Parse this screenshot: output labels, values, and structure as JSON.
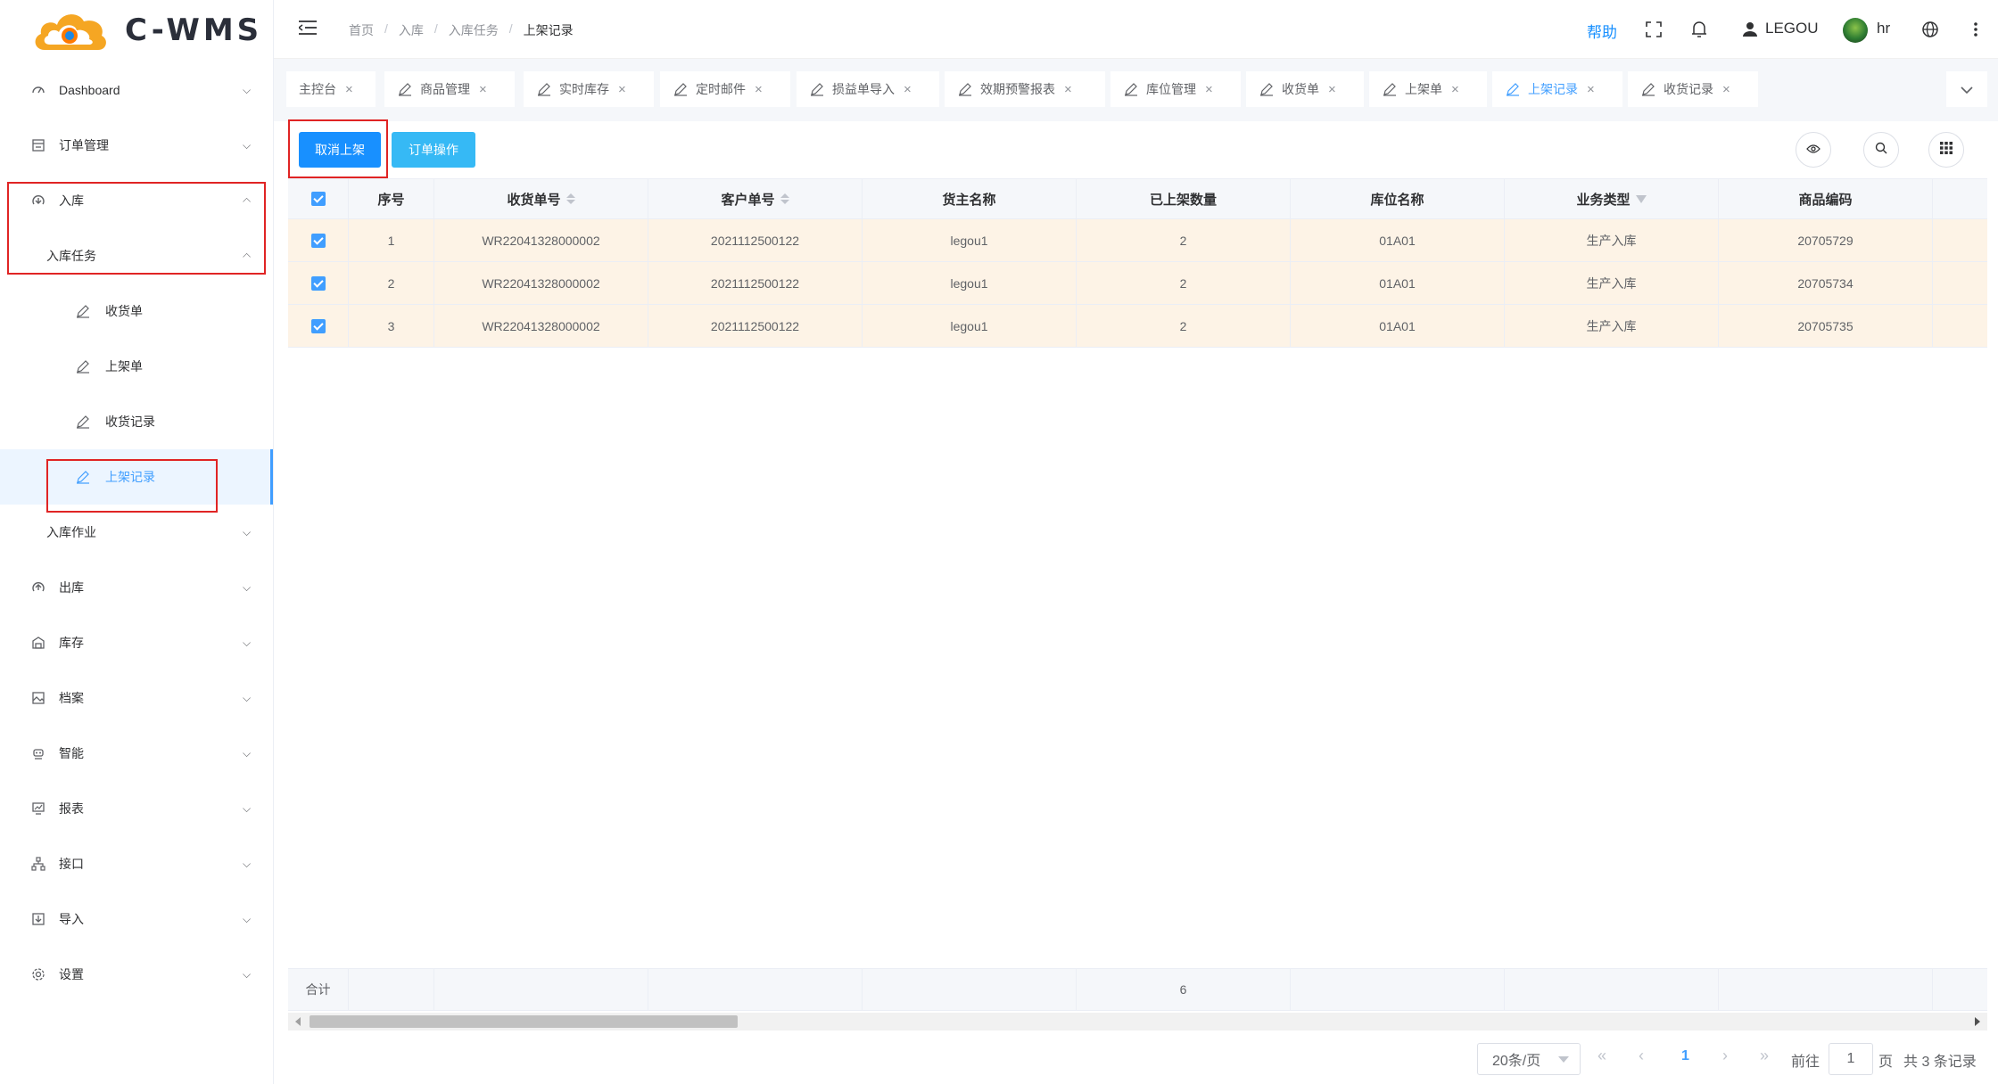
{
  "app": {
    "logo_text": "C-WMS"
  },
  "header": {
    "breadcrumb": [
      "首页",
      "入库",
      "入库任务",
      "上架记录"
    ],
    "help_label": "帮助",
    "user_label": "LEGOU",
    "account_name": "hr"
  },
  "sidebar": {
    "dashboard": "Dashboard",
    "order_mgmt": "订单管理",
    "inbound": "入库",
    "inbound_task": "入库任务",
    "receipt": "收货单",
    "putaway": "上架单",
    "receipt_record": "收货记录",
    "putaway_record": "上架记录",
    "inbound_op": "入库作业",
    "outbound": "出库",
    "stock": "库存",
    "archive": "档案",
    "smart": "智能",
    "report": "报表",
    "interface": "接口",
    "import": "导入",
    "settings": "设置"
  },
  "tabs": [
    {
      "label": "主控台",
      "active": false
    },
    {
      "label": "商品管理",
      "active": false
    },
    {
      "label": "实时库存",
      "active": false
    },
    {
      "label": "定时邮件",
      "active": false
    },
    {
      "label": "损益单导入",
      "active": false
    },
    {
      "label": "效期预警报表",
      "active": false
    },
    {
      "label": "库位管理",
      "active": false
    },
    {
      "label": "收货单",
      "active": false
    },
    {
      "label": "上架单",
      "active": false
    },
    {
      "label": "上架记录",
      "active": true
    },
    {
      "label": "收货记录",
      "active": false
    }
  ],
  "toolbar": {
    "cancel_putaway": "取消上架",
    "order_ops": "订单操作"
  },
  "table": {
    "columns": [
      "序号",
      "收货单号",
      "客户单号",
      "货主名称",
      "已上架数量",
      "库位名称",
      "业务类型",
      "商品编码"
    ],
    "rows": [
      {
        "seq": "1",
        "receipt_no": "WR22041328000002",
        "customer_no": "2021112500122",
        "owner": "legou1",
        "qty": "2",
        "location": "01A01",
        "biz_type": "生产入库",
        "sku": "20705729"
      },
      {
        "seq": "2",
        "receipt_no": "WR22041328000002",
        "customer_no": "2021112500122",
        "owner": "legou1",
        "qty": "2",
        "location": "01A01",
        "biz_type": "生产入库",
        "sku": "20705734"
      },
      {
        "seq": "3",
        "receipt_no": "WR22041328000002",
        "customer_no": "2021112500122",
        "owner": "legou1",
        "qty": "2",
        "location": "01A01",
        "biz_type": "生产入库",
        "sku": "20705735"
      }
    ],
    "summary_label": "合计",
    "summary_qty": "6"
  },
  "pagination": {
    "page_size": "20条/页",
    "current_page": "1",
    "goto_label": "前往",
    "goto_value": "1",
    "page_unit": "页",
    "total_text": "共 3 条记录"
  },
  "colors": {
    "primary": "#1890ff",
    "info": "#36b9f5",
    "row_highlight": "#fdf3e6",
    "annotation": "#e02424"
  }
}
